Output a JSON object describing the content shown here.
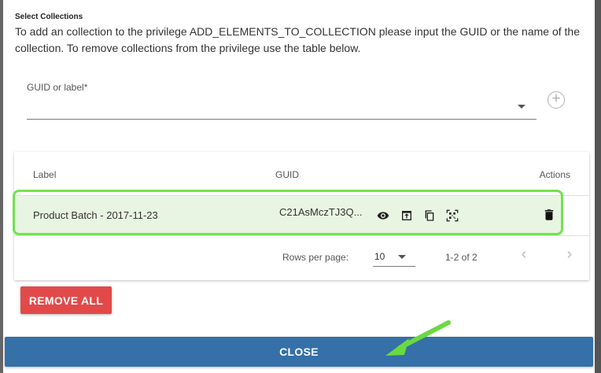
{
  "dialog": {
    "heading": "Select Collections",
    "description": "To add an collection to the privilege ADD_ELEMENTS_TO_COLLECTION please input the GUID or the name of the collection. To remove collections from the privilege use the table below."
  },
  "input": {
    "label": "GUID or label*",
    "value": ""
  },
  "table": {
    "columns": [
      "Label",
      "GUID",
      "Actions"
    ],
    "rows": [
      {
        "label": "Product Batch - 2017-11-23",
        "guid": "C21AsMczTJ3Q..."
      }
    ],
    "row_icons": [
      "eye-icon",
      "open-in-new-icon",
      "copy-icon",
      "qr-code-icon",
      "delete-icon"
    ],
    "pagination": {
      "rows_per_page_label": "Rows per page:",
      "rows_per_page_value": "10",
      "range": "1-2 of 2"
    }
  },
  "buttons": {
    "remove_all": "REMOVE ALL",
    "close": "CLOSE"
  },
  "colors": {
    "remove_all": "#e24a4a",
    "close": "#3570a8",
    "row_highlight": "#73e24f",
    "annotation_arrow": "#6ad93f"
  }
}
